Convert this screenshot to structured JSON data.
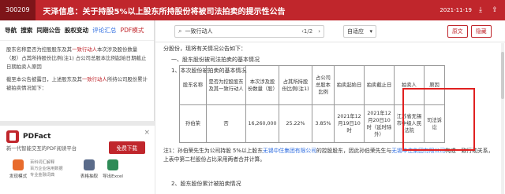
{
  "header": {
    "code": "300209",
    "title": "天泽信息：关于持股5%以上股东所持股份将被司法拍卖的提示性公告",
    "date": "2021-11-19"
  },
  "nav": {
    "items": [
      "导航",
      "搜索",
      "同期公告",
      "股权变动",
      "评论汇总",
      "PDF模式"
    ]
  },
  "announcement": {
    "p1_prefix": "股东名称是否为控股股东及其",
    "p1_red": "一致行动人",
    "p1_rest": "本次涉及股份数量（股）占其所持股份比例(注1) 占公司总股本比例起始日期截止日期拍卖人原因",
    "p2_prefix": "截至本公告披露日，上述股东及其",
    "p2_red": "一致行动人",
    "p2_rest": "所持公司股份累计被拍卖情况如下："
  },
  "ad": {
    "name": "PDFact",
    "subtitle": "新一代智能交互的PDF阅读平台",
    "free_button": "免费下载",
    "close": "×",
    "features": [
      {
        "label": "发现模式",
        "color": "#e86b2c"
      },
      {
        "label": "表格抽取",
        "color": "#5a6b8a"
      },
      {
        "label": "导出Excel",
        "color": "#2e8b57"
      }
    ],
    "list": [
      "百科词汇解释",
      "百万企业信用数据",
      "专业金融词典"
    ]
  },
  "reader": {
    "search_value": "一致行动人",
    "match_count": "1/2",
    "zoom": "自适应",
    "original_label": "原文",
    "cancel_label": "隐藏"
  },
  "doc": {
    "line1": "分股份，现将有关情况公告如下：",
    "line2": "一、股东股份被司法拍卖的基本情况",
    "line3": "1、本次股份被拍卖的基本情况",
    "headers": [
      "股东名称",
      "是否为控股股东及其一致行动人",
      "本次涉及股份数量（股）",
      "占其所持股份比例(注1)",
      "占公司总股本比例",
      "拍卖起始日",
      "拍卖截止日",
      "拍卖人",
      "原因"
    ],
    "row": [
      "孙伯荣",
      "否",
      "16,260,000",
      "25.22%",
      "3.85%",
      "2021年12月19日10时",
      "2021年12月20日10时（延时除外）",
      "江苏省无锡市中级人民法院",
      "司法诉讼"
    ],
    "note_a": "注1：孙伯荣先生为公司持股 5%以上股东",
    "note_link1": "无锡中住集团有限公司",
    "note_b": "的控股股东，因此孙伯荣先生与",
    "note_link2": "无锡中住集团有限公司",
    "note_c": "构成一致行动关系，上表中第二栏股份占比采用两者合并计算。",
    "line_last": "2、股东股份累计被拍卖情况"
  }
}
